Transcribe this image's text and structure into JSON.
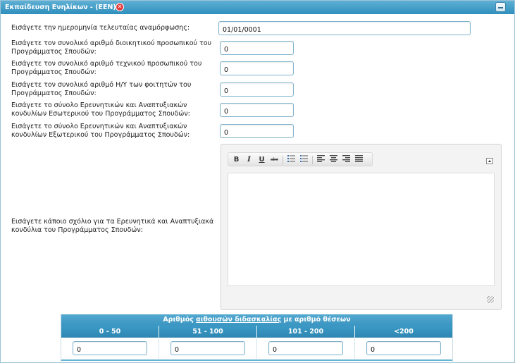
{
  "panel": {
    "title": "Εκπαίδευση Ενηλίκων - (EEN)",
    "close_icon": "✕",
    "collapse_icon": "minus-icon"
  },
  "form": {
    "rows": [
      {
        "label": "Εισάγετε την ημερομηνία τελευταίας αναμόρφωσης:",
        "value": "01/01/0001"
      },
      {
        "label": "Εισάγετε τον συνολικό αριθμό διοικητικού προσωπικού του Προγράμματος Σπουδών:",
        "value": "0"
      },
      {
        "label": "Εισάγετε τον συνολικό αριθμό τεχνικού προσωπικού του Προγράμματος Σπουδών:",
        "value": "0"
      },
      {
        "label": "Εισάγετε τον συνολικό αριθμό Η/Υ των φοιτητών του Προγράμματος Σπουδών:",
        "value": "0"
      },
      {
        "label": "Εισάγετε το σύνολο Ερευνητικών και Αναπτυξιακών κονδυλίων Εσωτερικού του Προγράμματος Σπουδών:",
        "value": "0"
      },
      {
        "label": "Εισάγετε το σύνολο Ερευνητικών και Αναπτυξιακών κονδυλίων Εξωτερικού του Προγράμματος Σπουδών:",
        "value": "0"
      }
    ],
    "comment_label": "Εισάγετε κάποιο σχόλιο για τα Ερευνητικά και Αναπτυξιακά κονδύλια του Προγράμματος Σπουδών:"
  },
  "editor": {
    "toolbar": {
      "bold": "B",
      "italic": "I",
      "underline": "U",
      "strike": "abc"
    },
    "content": ""
  },
  "rooms": {
    "title_prefix": "Αριθμός ",
    "title_link": "αιθουσών διδασκαλίας",
    "title_suffix": " με αριθμό θέσεων",
    "columns": [
      "0 - 50",
      "51 - 100",
      "101 - 200",
      "<200"
    ],
    "values": [
      "0",
      "0",
      "0",
      "0"
    ]
  },
  "colors": {
    "header": "#3a95c1",
    "field_border": "#7fb3cc",
    "close": "#e23a3a"
  }
}
